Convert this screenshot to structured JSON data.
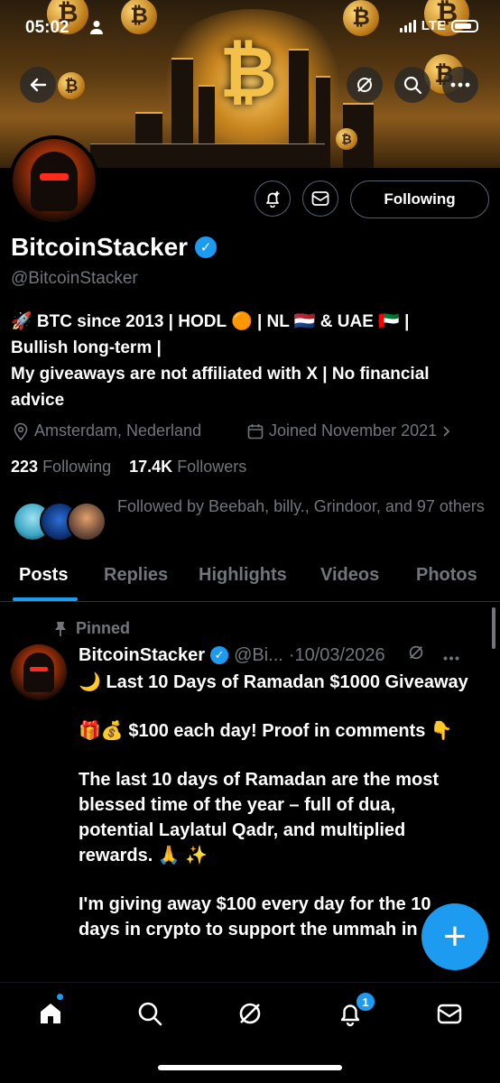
{
  "status": {
    "time": "05:02",
    "network": "LTE"
  },
  "header_icons": [
    "back-arrow-icon",
    "grok-icon",
    "search-icon",
    "more-icon"
  ],
  "profile": {
    "name": "BitcoinStacker",
    "handle": "@BitcoinStacker",
    "bio_lines": [
      "🚀 BTC since 2013 | HODL 🟠 | NL 🇳🇱 & UAE 🇦🇪 |",
      "Bullish long-term |",
      "My giveaways are not affiliated with X | No financial",
      "advice"
    ],
    "location": "Amsterdam, Nederland",
    "joined": "Joined November 2021",
    "following_count": "223",
    "following_label": "Following",
    "followers_count": "17.4K",
    "followers_label": "Followers",
    "followed_by_text": "Followed by Beebah, billy., Grindoor, and 97 others",
    "follow_button_label": "Following"
  },
  "tabs": [
    {
      "label": "Posts",
      "active": true
    },
    {
      "label": "Replies"
    },
    {
      "label": "Highlights"
    },
    {
      "label": "Videos"
    },
    {
      "label": "Photos"
    }
  ],
  "post": {
    "pinned_label": "Pinned",
    "author": "BitcoinStacker",
    "handle": "@Bi...",
    "date": "·10/03/2026",
    "paragraphs": [
      "🌙 Last 10 Days of Ramadan $1000 Giveaway",
      "🎁💰 $100 each day! Proof in comments 👇",
      "The last 10 days of Ramadan are the most blessed time of the year – full of dua, potential Laylatul Qadr, and multiplied rewards. 🙏 ✨",
      "I'm giving away $100 every day for the 10 days in crypto to support the ummah in"
    ]
  },
  "fab_label": "+",
  "bottom_nav": {
    "items": [
      "home-icon",
      "search-icon",
      "grok-icon",
      "notifications-icon",
      "messages-icon"
    ],
    "notification_badge": "1"
  },
  "colors": {
    "accent": "#1d9bf0",
    "background": "#000000",
    "muted": "#71767b"
  }
}
